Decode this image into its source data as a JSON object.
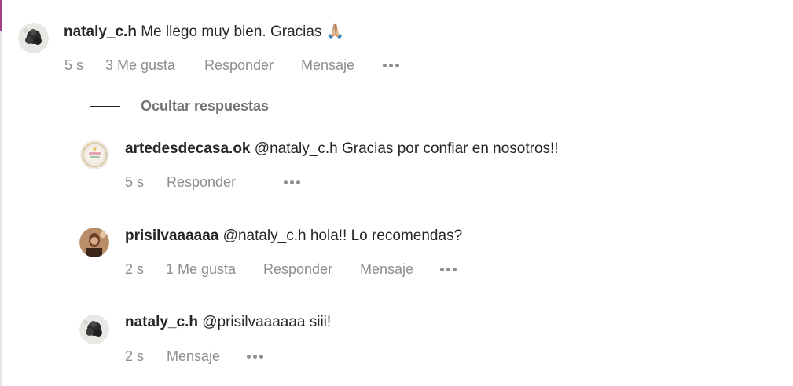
{
  "comments": [
    {
      "username": "nataly_c.h",
      "text": "Me llego muy bien. Gracias",
      "emoji": "🙏🏼",
      "time": "5 s",
      "likes": "3 Me gusta",
      "reply_label": "Responder",
      "message_label": "Mensaje"
    }
  ],
  "hide_replies_label": "Ocultar respuestas",
  "replies": [
    {
      "username": "artedesdecasa.ok",
      "text": "@nataly_c.h Gracias por confiar en nosotros!!",
      "time": "5 s",
      "reply_label": "Responder"
    },
    {
      "username": "prisilvaaaaaa",
      "text": "@nataly_c.h hola!! Lo recomendas?",
      "time": "2 s",
      "likes": "1 Me gusta",
      "reply_label": "Responder",
      "message_label": "Mensaje"
    },
    {
      "username": "nataly_c.h",
      "text": "@prisilvaaaaaa siii!",
      "time": "2 s",
      "message_label": "Mensaje"
    }
  ],
  "colors": {
    "text": "#262626",
    "meta": "#8e8e8e",
    "accent": "#a0408a"
  },
  "icons": [
    "more-options-icon"
  ]
}
